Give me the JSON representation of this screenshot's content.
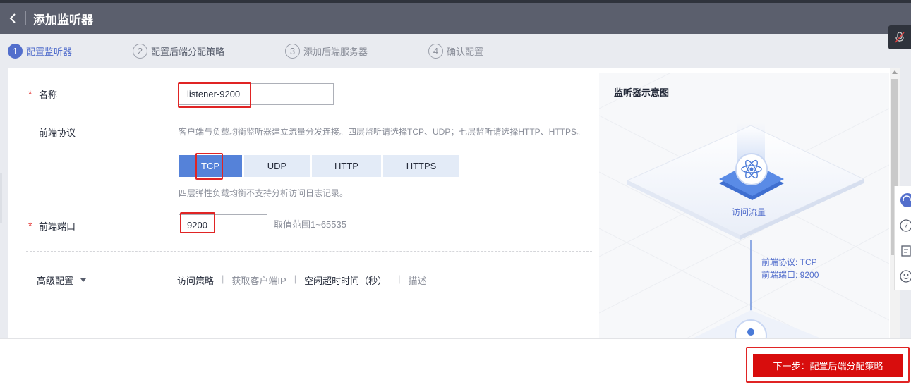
{
  "header": {
    "title": "添加监听器",
    "back_icon": "chevron-left-icon"
  },
  "steps": [
    {
      "num": "1",
      "label": "配置监听器",
      "state": "active"
    },
    {
      "num": "2",
      "label": "配置后端分配策略",
      "state": "pending"
    },
    {
      "num": "3",
      "label": "添加后端服务器",
      "state": "pending"
    },
    {
      "num": "4",
      "label": "确认配置",
      "state": "pending"
    }
  ],
  "form": {
    "name": {
      "required_mark": "*",
      "label": "名称",
      "value": "listener-9200"
    },
    "protocol": {
      "label": "前端协议",
      "hint": "客户端与负载均衡监听器建立流量分发连接。四层监听请选择TCP、UDP；七层监听请选择HTTP、HTTPS。",
      "options": [
        "TCP",
        "UDP",
        "HTTP",
        "HTTPS"
      ],
      "selected": "TCP",
      "note": "四层弹性负载均衡不支持分析访问日志记录。"
    },
    "port": {
      "required_mark": "*",
      "label": "前端端口",
      "value": "9200",
      "range_hint": "取值范围1~65535"
    },
    "advanced": {
      "label": "高级配置",
      "links": [
        "访问策略",
        "获取客户端IP",
        "空闲超时时间（秒）",
        "描述"
      ],
      "separator": "|"
    }
  },
  "diagram": {
    "title": "监听器示意图",
    "node_label": "访问流量",
    "protocol_text": "前端协议: TCP",
    "port_text": "前端端口: 9200"
  },
  "footer": {
    "next_label": "下一步：配置后端分配策略"
  },
  "colors": {
    "accent": "#526ecc",
    "selected_protocol": "#5582d9",
    "danger": "#d80d0d",
    "header_bg": "#5b5f6d"
  }
}
